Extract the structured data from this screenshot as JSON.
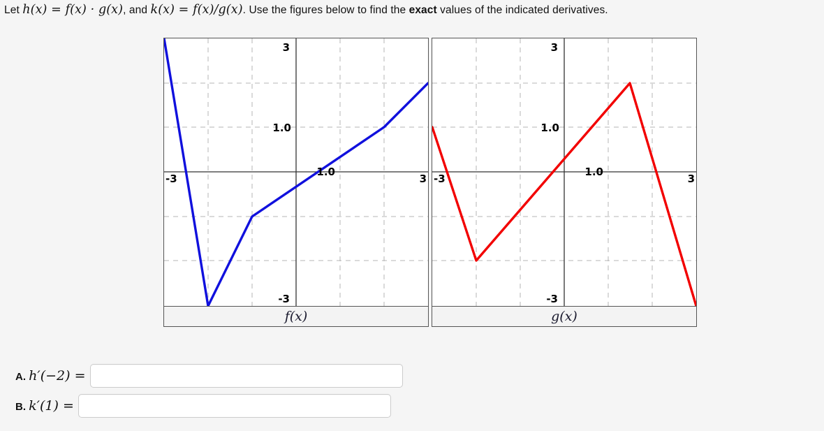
{
  "prompt": {
    "segment_1": "Let ",
    "math_h": "h(x)",
    "eq1": " = ",
    "math_fg": "f(x) · g(x)",
    "segment_2": ", and ",
    "math_k": "k(x)",
    "eq2": " = ",
    "math_fdg": "f(x)/g(x)",
    "segment_3": ". Use the figures below to find the ",
    "emphasis": "exact",
    "segment_4": " values of the indicated derivatives.",
    "full_text": "Let h(x) = f(x) · g(x), and k(x) = f(x)/g(x). Use the figures below to find the exact values of the indicated derivatives."
  },
  "figures": [
    {
      "caption": "f(x)",
      "curve_color": "#1010dd",
      "axis_tick_x": "1.0",
      "axis_tick_y": "1.0",
      "label_left": "-3",
      "label_right": "3",
      "label_top": "3",
      "label_bottom": "-3"
    },
    {
      "caption": "g(x)",
      "curve_color": "#f20000",
      "axis_tick_x": "1.0",
      "axis_tick_y": "1.0",
      "label_left": "-3",
      "label_right": "3",
      "label_top": "3",
      "label_bottom": "-3"
    }
  ],
  "answers": [
    {
      "letter": "A.",
      "math_expr": "h′(−2)",
      "equals": " = ",
      "value": "",
      "placeholder": ""
    },
    {
      "letter": "B.",
      "math_expr": "k′(1)",
      "equals": " = ",
      "value": "",
      "placeholder": ""
    }
  ],
  "chart_data": [
    {
      "type": "line",
      "title": "f(x)",
      "xlabel": "",
      "ylabel": "",
      "xlim": [
        -3,
        3
      ],
      "ylim": [
        -3,
        3
      ],
      "grid": true,
      "legend": "none",
      "xticks": [
        -3,
        3
      ],
      "yticks": [
        -3,
        3
      ],
      "tick_labels": [
        "1.0",
        "1.0",
        "-3",
        "3",
        "3",
        "-3"
      ],
      "series": [
        {
          "name": "f",
          "color": "#1010dd",
          "points": [
            [
              -3,
              3
            ],
            [
              -2,
              -3
            ],
            [
              -1,
              -1
            ],
            [
              2,
              1
            ],
            [
              3,
              2
            ]
          ]
        }
      ]
    },
    {
      "type": "line",
      "title": "g(x)",
      "xlabel": "",
      "ylabel": "",
      "xlim": [
        -3,
        3
      ],
      "ylim": [
        -3,
        3
      ],
      "grid": true,
      "legend": "none",
      "xticks": [
        -3,
        3
      ],
      "yticks": [
        -3,
        3
      ],
      "tick_labels": [
        "1.0",
        "1.0",
        "-3",
        "3",
        "3",
        "-3"
      ],
      "series": [
        {
          "name": "g",
          "color": "#f20000",
          "points": [
            [
              -3,
              1
            ],
            [
              -2,
              -2
            ],
            [
              1.5,
              2
            ],
            [
              3,
              -3
            ]
          ]
        }
      ]
    }
  ]
}
